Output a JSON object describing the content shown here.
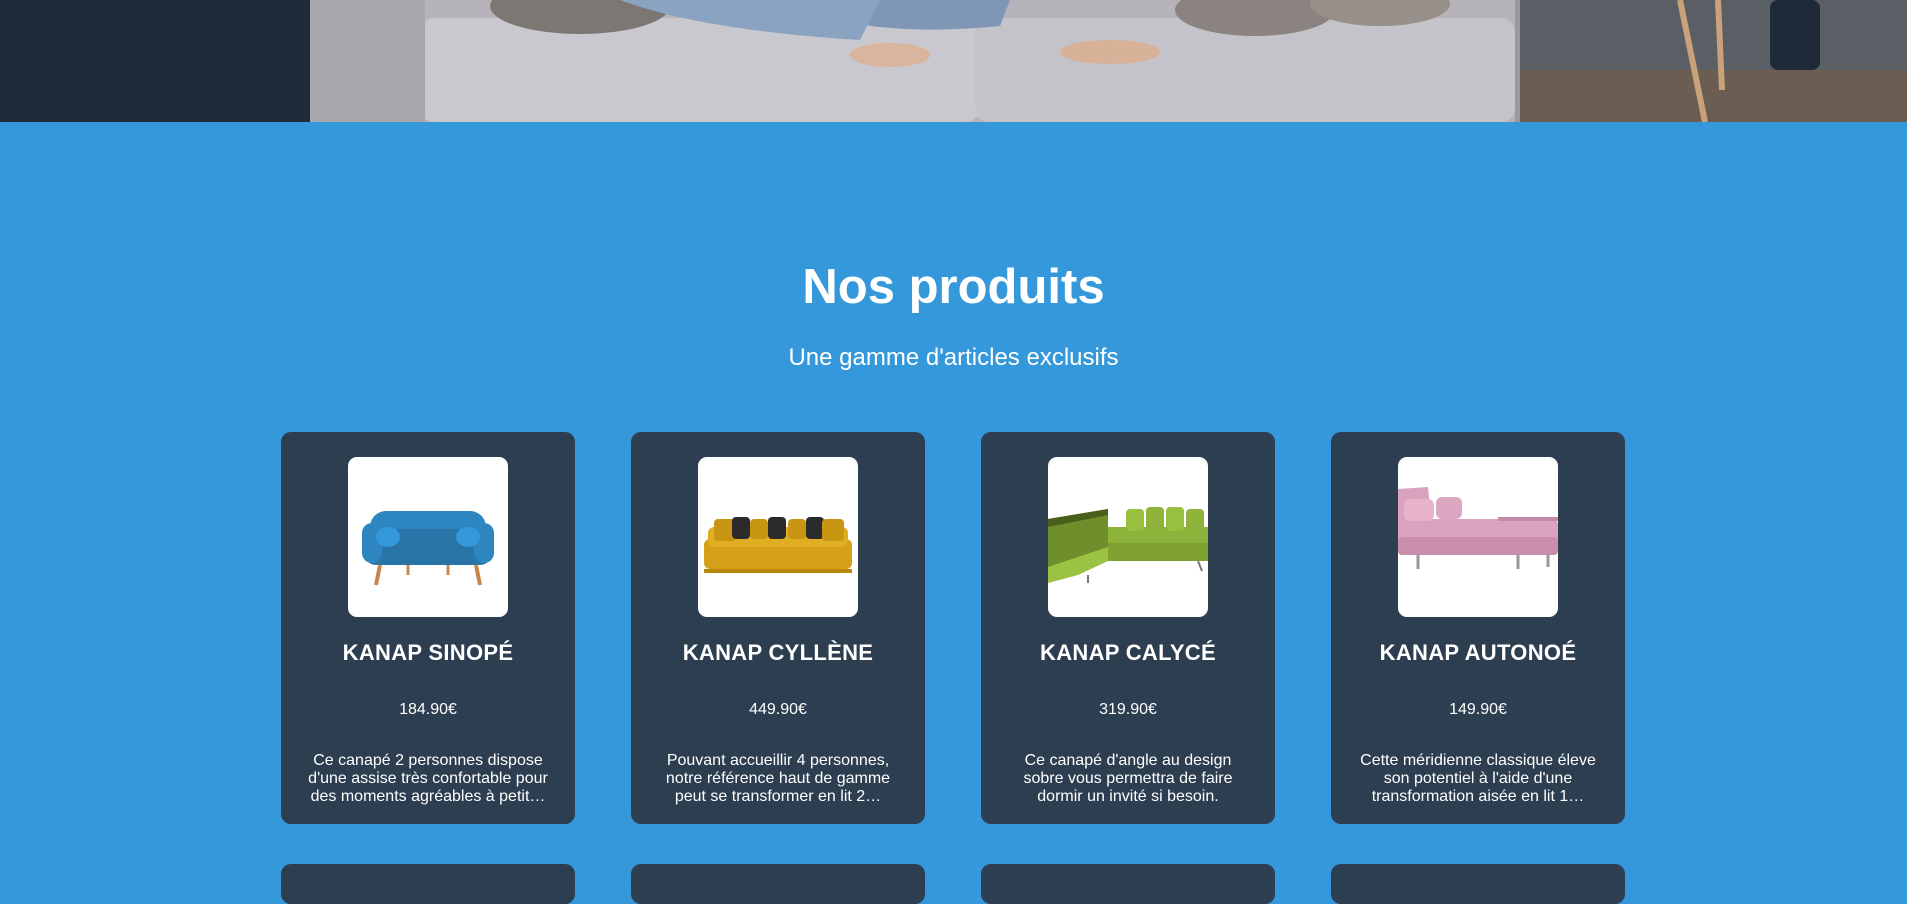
{
  "section": {
    "title": "Nos produits",
    "subtitle": "Une gamme d'articles exclusifs"
  },
  "products": [
    {
      "name": "KANAP SINOPÉ",
      "price": "184.90€",
      "description": "Ce canapé 2 personnes dispose d'une assise très confortable pour des moments agréables à petit…",
      "image": "blue-sofa-image",
      "color": "#2e86c1"
    },
    {
      "name": "KANAP CYLLÈNE",
      "price": "449.90€",
      "description": "Pouvant accueillir 4 personnes, notre référence haut de gamme peut se transformer en lit 2…",
      "image": "yellow-sofa-image",
      "color": "#d4a017"
    },
    {
      "name": "KANAP CALYCÉ",
      "price": "319.90€",
      "description": "Ce canapé d'angle au design sobre vous permettra de faire dormir un invité si besoin.",
      "image": "green-corner-sofa-image",
      "color": "#8db33a"
    },
    {
      "name": "KANAP AUTONOÉ",
      "price": "149.90€",
      "description": "Cette méridienne classique éleve son potentiel à l'aide d'une transformation aisée en lit 1…",
      "image": "pink-daybed-image",
      "color": "#d9a3bd"
    }
  ],
  "colors": {
    "section_bg": "#3498db",
    "card_bg": "#2c3e50",
    "text": "#ffffff"
  }
}
